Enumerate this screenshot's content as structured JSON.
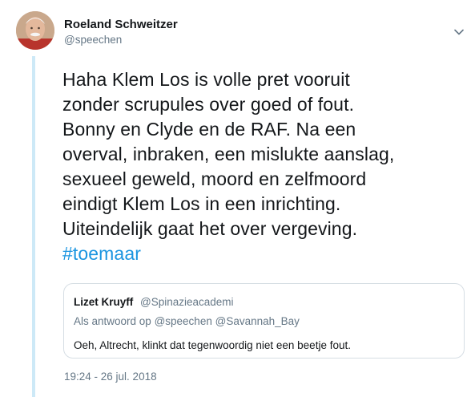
{
  "tweet": {
    "author": {
      "name": "Roeland Schweitzer",
      "handle": "@speechen",
      "avatar_icon": "avatar-photo"
    },
    "menu_icon": "chevron-down-icon",
    "text_lines": [
      "Haha Klem Los is volle pret vooruit",
      "zonder scrupules over goed of fout.",
      "Bonny en Clyde en de RAF. Na een",
      "overval, inbraken, een mislukte aanslag,",
      "sexueel geweld, moord en zelfmoord",
      "eindigt Klem Los in een inrichting.",
      "Uiteindelijk gaat het over vergeving."
    ],
    "hashtag": "#toemaar",
    "timestamp": "19:24 - 26 jul. 2018"
  },
  "quoted_tweet": {
    "author_name": "Lizet Kruyff",
    "author_handle": "@Spinazieacademi",
    "reply_prefix": "Als antwoord op",
    "reply_to": [
      "@speechen",
      "@Savannah_Bay"
    ],
    "text": "Oeh, Altrecht, klinkt dat tegenwoordig niet een beetje fout."
  },
  "colors": {
    "link": "#1b95e0",
    "secondary_text": "#657786",
    "thread_line": "#cde9f7",
    "border": "#d6dee4"
  }
}
